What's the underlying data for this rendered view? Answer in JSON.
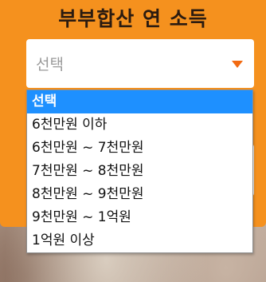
{
  "form": {
    "title": "부부합산 연 소득",
    "select": {
      "current_value": "선택",
      "caret_icon": "caret-down-icon",
      "accent_color": "#f26a11"
    },
    "options": [
      {
        "label": "선택",
        "selected": true
      },
      {
        "label": "6천만원 이하",
        "selected": false
      },
      {
        "label": "6천만원 ~ 7천만원",
        "selected": false
      },
      {
        "label": "7천만원 ~ 8천만원",
        "selected": false
      },
      {
        "label": "8천만원 ~ 9천만원",
        "selected": false
      },
      {
        "label": "9천만원 ~ 1억원",
        "selected": false
      },
      {
        "label": "1억원 이상",
        "selected": false
      }
    ]
  },
  "colors": {
    "panel": "#f5911e",
    "highlight": "#1e90ff"
  }
}
